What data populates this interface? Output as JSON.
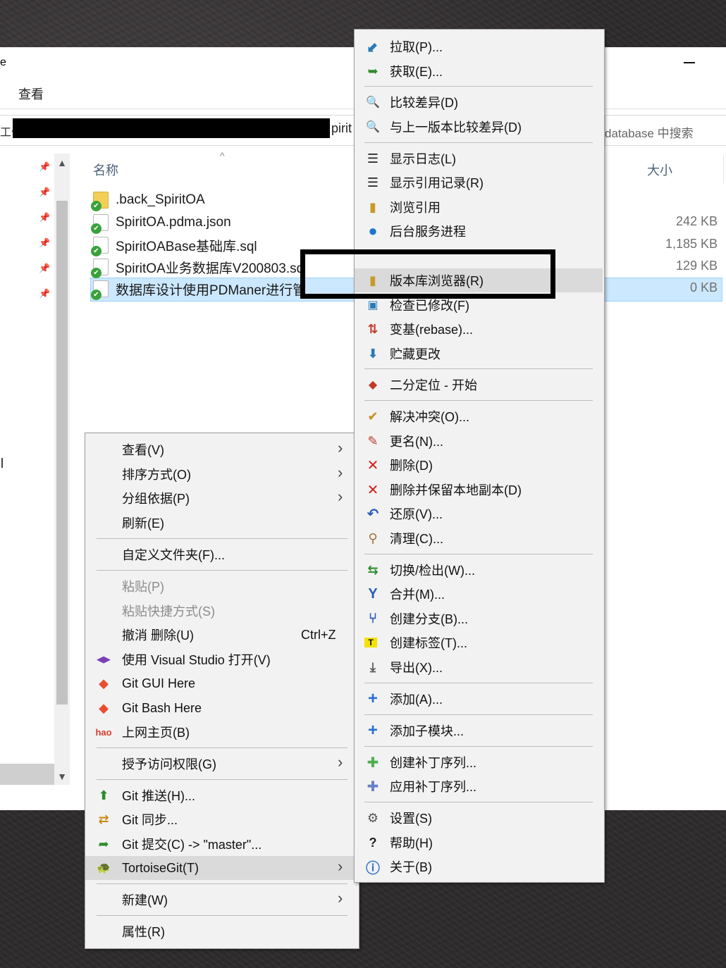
{
  "explorer": {
    "title_fragment": "e",
    "ribbon_tab": "查看",
    "address_left_fragment": "工作",
    "address_right_fragment": "pirit",
    "search_placeholder": "database 中搜索",
    "columns": {
      "name": "名称",
      "size": "大小"
    },
    "files": [
      {
        "name": ".back_SpiritOA",
        "size": "",
        "type": "folder"
      },
      {
        "name": "SpiritOA.pdma.json",
        "size": "242 KB",
        "type": "file"
      },
      {
        "name": "SpiritOABase基础库.sql",
        "size": "1,185 KB",
        "type": "file"
      },
      {
        "name": "SpiritOA业务数据库V200803.sq",
        "size": "129 KB",
        "type": "file"
      },
      {
        "name": "数据库设计使用PDManer进行管",
        "size": "0 KB",
        "type": "file",
        "selected": true
      }
    ]
  },
  "context_menu": {
    "items": [
      {
        "label": "查看(V)",
        "submenu": true
      },
      {
        "label": "排序方式(O)",
        "submenu": true
      },
      {
        "label": "分组依据(P)",
        "submenu": true
      },
      {
        "label": "刷新(E)"
      },
      {
        "label": "自定义文件夹(F)..."
      },
      {
        "label": "粘贴(P)",
        "disabled": true
      },
      {
        "label": "粘贴快捷方式(S)",
        "disabled": true
      },
      {
        "label": "撤消 删除(U)",
        "shortcut": "Ctrl+Z"
      },
      {
        "label": "使用 Visual Studio 打开(V)",
        "icon": "visual-studio-icon"
      },
      {
        "label": "Git GUI Here",
        "icon": "git-gui-icon"
      },
      {
        "label": "Git Bash Here",
        "icon": "git-bash-icon"
      },
      {
        "label": "上网主页(B)",
        "icon": "hao-icon",
        "icon_text": "hao"
      },
      {
        "label": "授予访问权限(G)",
        "submenu": true
      },
      {
        "label": "Git 推送(H)...",
        "icon": "git-push-icon"
      },
      {
        "label": "Git 同步...",
        "icon": "git-sync-icon"
      },
      {
        "label": "Git 提交(C) -> \"master\"...",
        "icon": "git-commit-icon"
      },
      {
        "label": "TortoiseGit(T)",
        "icon": "tortoisegit-icon",
        "submenu": true,
        "hover": true
      },
      {
        "label": "新建(W)",
        "submenu": true
      },
      {
        "label": "属性(R)"
      }
    ]
  },
  "tortoise_menu": {
    "items": [
      {
        "label": "拉取(P)...",
        "icon": "pull-icon"
      },
      {
        "label": "获取(E)...",
        "icon": "fetch-icon"
      },
      {
        "label": "比较差异(D)",
        "icon": "diff-icon"
      },
      {
        "label": "与上一版本比较差异(D)",
        "icon": "diff-previous-icon"
      },
      {
        "label": "显示日志(L)",
        "icon": "log-icon"
      },
      {
        "label": "显示引用记录(R)",
        "icon": "reflog-icon"
      },
      {
        "label": "浏览引用",
        "icon": "browse-refs-icon"
      },
      {
        "label": "后台服务进程",
        "icon": "daemon-icon"
      },
      {
        "label": "版本库浏览器(R)",
        "icon": "repo-browser-icon",
        "highlighted": true
      },
      {
        "label": "检查已修改(F)",
        "icon": "check-modifications-icon"
      },
      {
        "label": "变基(rebase)...",
        "icon": "rebase-icon"
      },
      {
        "label": "贮藏更改",
        "icon": "stash-icon"
      },
      {
        "label": "二分定位 - 开始",
        "icon": "bisect-icon"
      },
      {
        "label": "解决冲突(O)...",
        "icon": "resolve-icon"
      },
      {
        "label": "更名(N)...",
        "icon": "rename-icon"
      },
      {
        "label": "删除(D)",
        "icon": "delete-icon"
      },
      {
        "label": "删除并保留本地副本(D)",
        "icon": "delete-keep-icon"
      },
      {
        "label": "还原(V)...",
        "icon": "revert-icon"
      },
      {
        "label": "清理(C)...",
        "icon": "cleanup-icon"
      },
      {
        "label": "切换/检出(W)...",
        "icon": "switch-icon"
      },
      {
        "label": "合并(M)...",
        "icon": "merge-icon"
      },
      {
        "label": "创建分支(B)...",
        "icon": "branch-icon"
      },
      {
        "label": "创建标签(T)...",
        "icon": "tag-icon"
      },
      {
        "label": "导出(X)...",
        "icon": "export-icon"
      },
      {
        "label": "添加(A)...",
        "icon": "add-icon"
      },
      {
        "label": "添加子模块...",
        "icon": "add-submodule-icon"
      },
      {
        "label": "创建补丁序列...",
        "icon": "create-patch-icon"
      },
      {
        "label": "应用补丁序列...",
        "icon": "apply-patch-icon"
      },
      {
        "label": "设置(S)",
        "icon": "settings-icon"
      },
      {
        "label": "帮助(H)",
        "icon": "help-icon"
      },
      {
        "label": "关于(B)",
        "icon": "about-icon"
      }
    ]
  },
  "colors": {
    "selection": "#cce8ff",
    "menu_bg": "#f2f2f2",
    "menu_hover": "#dadada"
  }
}
